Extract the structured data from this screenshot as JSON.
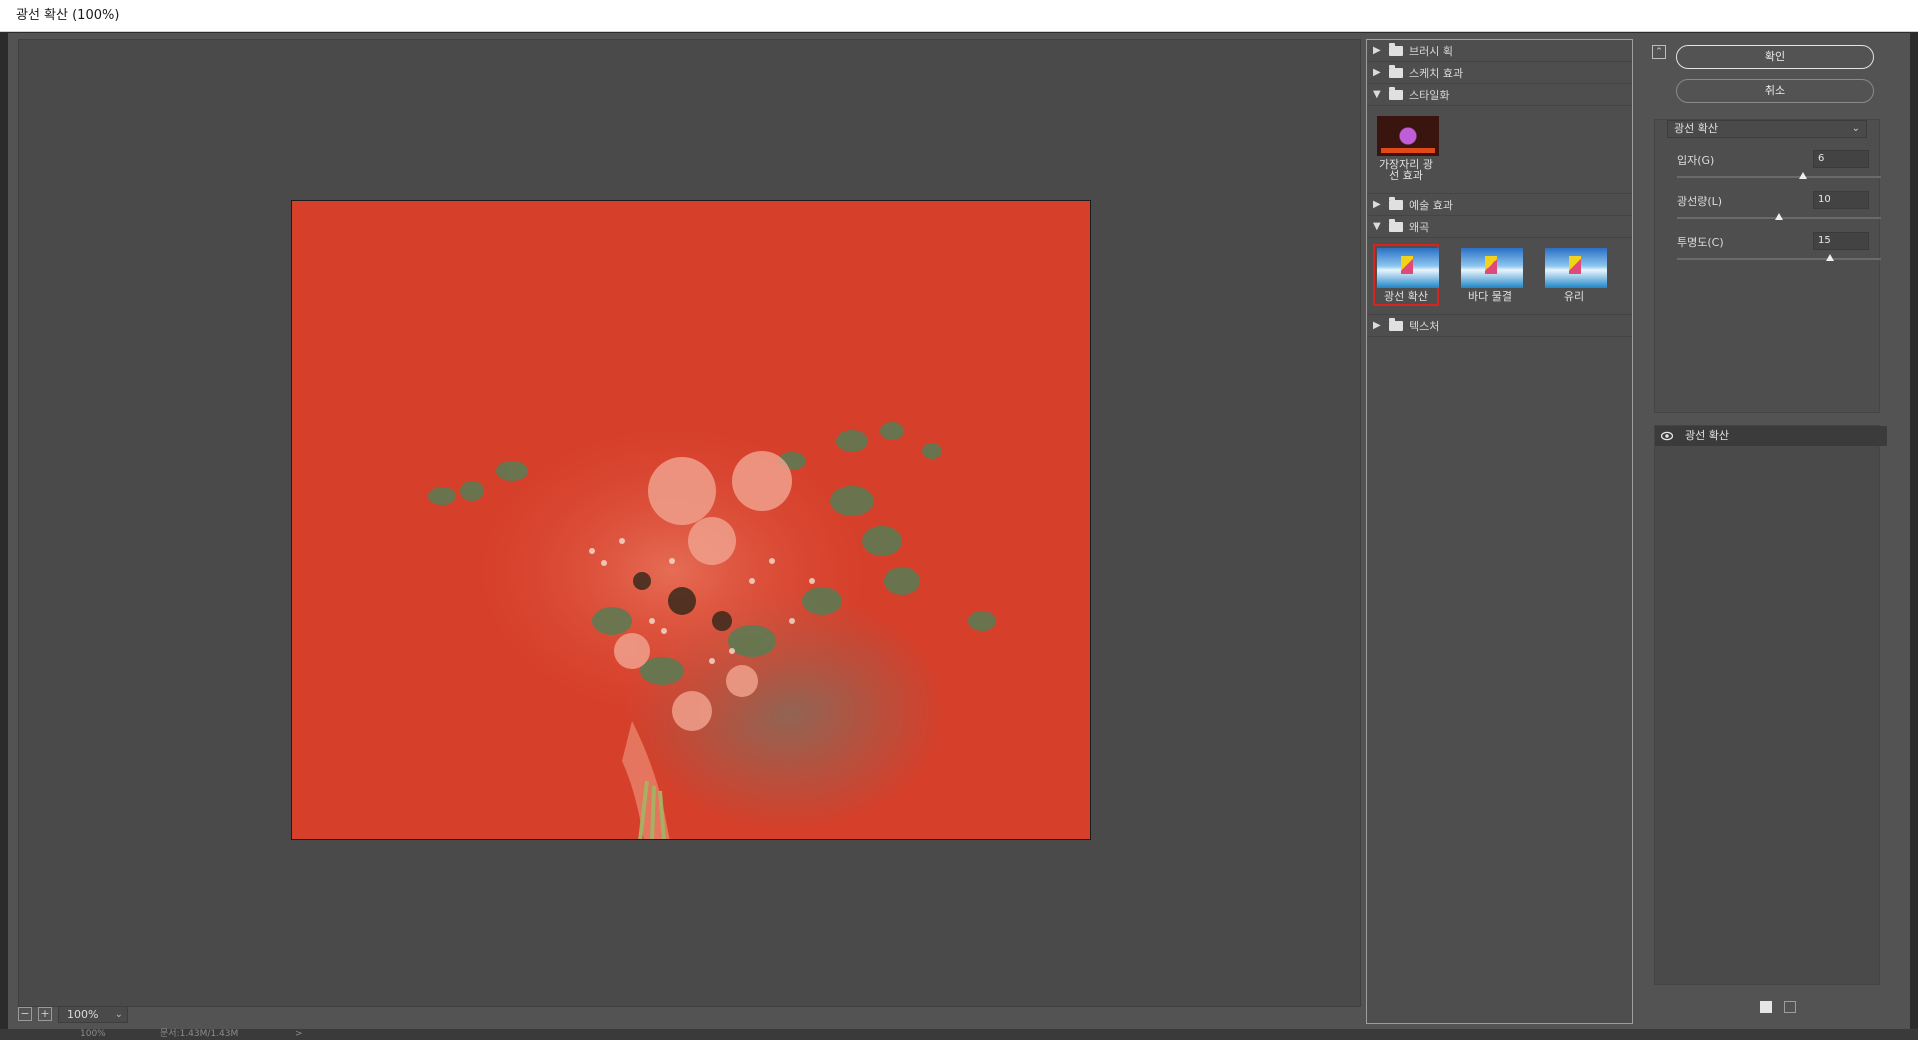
{
  "window": {
    "title": "광선 확산 (100%)"
  },
  "preview": {
    "zoom_value": "100%",
    "zoom_out_symbol": "−",
    "zoom_in_symbol": "+"
  },
  "gallery": {
    "folders": [
      {
        "label": "브러시 획",
        "expanded": false
      },
      {
        "label": "스케치 효과",
        "expanded": false
      },
      {
        "label": "스타일화",
        "expanded": true,
        "items": [
          {
            "label": "가장자리 광선 효과",
            "icon": "dark-glow-thumb"
          }
        ]
      },
      {
        "label": "예술 효과",
        "expanded": false
      },
      {
        "label": "왜곡",
        "expanded": true,
        "items": [
          {
            "label": "광선 확산",
            "icon": "sea-thumb",
            "selected": true
          },
          {
            "label": "바다 물결",
            "icon": "sea-thumb"
          },
          {
            "label": "유리",
            "icon": "sea-thumb"
          }
        ]
      },
      {
        "label": "텍스처",
        "expanded": false
      }
    ]
  },
  "settings": {
    "ok_label": "확인",
    "cancel_label": "취소",
    "filter_select": "광선 확산",
    "params": [
      {
        "label": "입자(G)",
        "value": "6",
        "level": 0.62
      },
      {
        "label": "광선량(L)",
        "value": "10",
        "level": 0.5
      },
      {
        "label": "투명도(C)",
        "value": "15",
        "level": 0.75
      }
    ],
    "layer": {
      "name": "광선 확산"
    }
  },
  "status": {
    "zoom": "100%",
    "doc": "문서:1.43M/1.43M",
    "arrow": ">"
  },
  "colors": {
    "selection": "#d8231f",
    "canvas": "#d63f2a",
    "dialog": "#535353"
  }
}
